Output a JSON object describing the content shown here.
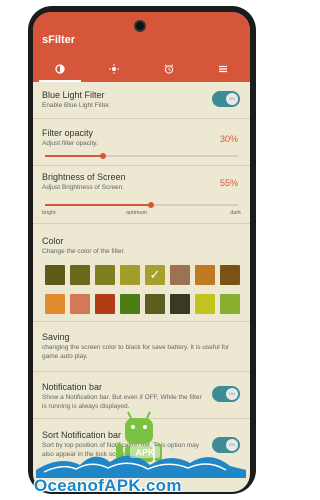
{
  "app": {
    "title": "sFilter"
  },
  "tabs": [
    {
      "icon": "brightness-icon",
      "active": true
    },
    {
      "icon": "sun-icon",
      "active": false
    },
    {
      "icon": "alarm-clock-icon",
      "active": false
    },
    {
      "icon": "menu-icon",
      "active": false
    }
  ],
  "settings": {
    "blue_light": {
      "title": "Blue Light Filter",
      "subtitle": "Enable Blue Light Filter.",
      "toggle": "ON",
      "enabled": true
    },
    "opacity": {
      "title": "Filter opacity",
      "subtitle": "Adjust filter opacity.",
      "value": "30%",
      "level": 0.3
    },
    "brightness": {
      "title": "Brightness of Screen",
      "subtitle": "Adjust Brightness of Screen.",
      "value": "55%",
      "level": 0.55,
      "labels": {
        "left": "bright",
        "middle": "optimum",
        "right": "dark"
      }
    },
    "color": {
      "title": "Color",
      "subtitle": "Change the color of the filter.",
      "swatches_row1": [
        "#5e5a17",
        "#6b6a1c",
        "#7d7f20",
        "#a39e2b",
        "#a8a02c",
        "#9b7253",
        "#c07a24",
        "#7c5116"
      ],
      "swatches_row2": [
        "#e38a2d",
        "#d27a55",
        "#b03c17",
        "#4c7d17",
        "#5a5f1d",
        "#3a3a22",
        "#c4c21c",
        "#88b030"
      ],
      "selected_index": 4,
      "check": "✓"
    },
    "saving": {
      "title": "Saving",
      "subtitle": "changing the screen color to black for save battery. It is useful for game auto play."
    },
    "notification": {
      "title": "Notification bar",
      "subtitle": "Show a Notification bar. But even if OFF, While the filter is running is always displayed.",
      "toggle": "ON",
      "enabled": true
    },
    "sort_notification": {
      "title": "Sort Notification bar",
      "subtitle": "Sort by top position of Notification bar. This option may also appear in the lock screen and use",
      "toggle": "ON",
      "enabled": true
    }
  },
  "watermark": {
    "text": "OceanofAPK.com",
    "badge": "APK"
  }
}
